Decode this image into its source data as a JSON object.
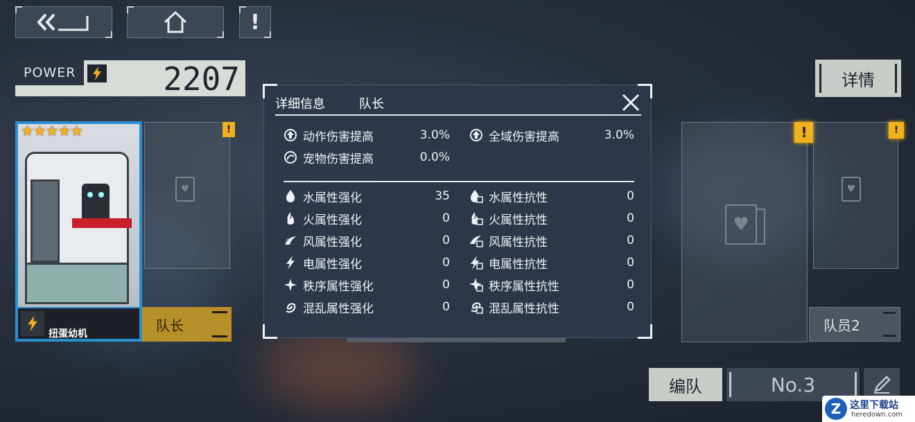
{
  "topbar": {
    "back_icon": "back-double-chevron-icon",
    "home_icon": "home-icon",
    "alert_label": "!"
  },
  "power": {
    "label": "POWER",
    "value": "2207"
  },
  "details_button": "详情",
  "leader_card": {
    "stars": "★★★★★",
    "name": "扭蛋幼机",
    "role_label": "队长"
  },
  "member_label": "队员2",
  "bottom": {
    "formation_label": "编队",
    "team_number": "No.3"
  },
  "modal": {
    "tab_details": "详细信息",
    "tab_leader": "队长",
    "bonuses": [
      {
        "label": "动作伤害提高",
        "value": "3.0%"
      },
      {
        "label": "全域伤害提高",
        "value": "3.0%"
      },
      {
        "label": "宠物伤害提高",
        "value": "0.0%"
      }
    ],
    "elements_left": [
      {
        "label": "水属性强化",
        "value": "35"
      },
      {
        "label": "火属性强化",
        "value": "0"
      },
      {
        "label": "风属性强化",
        "value": "0"
      },
      {
        "label": "电属性强化",
        "value": "0"
      },
      {
        "label": "秩序属性强化",
        "value": "0"
      },
      {
        "label": "混乱属性强化",
        "value": "0"
      }
    ],
    "elements_right": [
      {
        "label": "水属性抗性",
        "value": "0"
      },
      {
        "label": "火属性抗性",
        "value": "0"
      },
      {
        "label": "风属性抗性",
        "value": "0"
      },
      {
        "label": "电属性抗性",
        "value": "0"
      },
      {
        "label": "秩序属性抗性",
        "value": "0"
      },
      {
        "label": "混乱属性抗性",
        "value": "0"
      }
    ]
  },
  "watermark": {
    "site": "这里下载站",
    "url": "heredown.com"
  },
  "colors": {
    "accent_yellow": "#f0b21c",
    "leader_blue": "#2a8fd0",
    "modal_bg": "#2c384a"
  }
}
